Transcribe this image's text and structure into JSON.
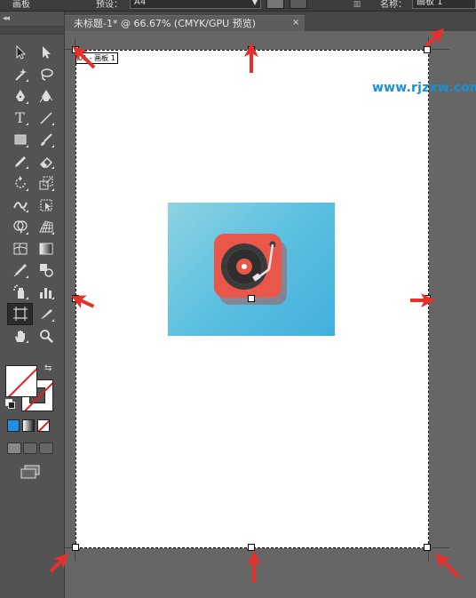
{
  "control_bar": {
    "tool_name": "画板",
    "preset_label": "预设：",
    "preset_value": "A4",
    "name_label": "名称：",
    "name_value": "画板 1"
  },
  "document": {
    "tab_title": "未标题-1* @ 66.67% (CMYK/GPU 预览)",
    "tab_close": "×"
  },
  "artboard": {
    "label": "01 - 画板 1"
  },
  "watermark": "www.rjzxw.com",
  "colors": {
    "fill": "#ffffff",
    "stroke": "none",
    "annotation_arrow": "#e8302a",
    "watermark": "#1a8fd6",
    "icon_background": "#5cc0e0",
    "icon_tile": "#e8574a"
  },
  "tools": [
    "selection-tool",
    "direct-selection-tool",
    "magic-wand-tool",
    "lasso-tool",
    "pen-tool",
    "curvature-tool",
    "type-tool",
    "line-segment-tool",
    "rectangle-tool",
    "paintbrush-tool",
    "pencil-tool",
    "eraser-tool",
    "rotate-tool",
    "scale-tool",
    "width-tool",
    "free-transform-tool",
    "shape-builder-tool",
    "perspective-grid-tool",
    "mesh-tool",
    "gradient-tool",
    "eyedropper-tool",
    "blend-tool",
    "symbol-sprayer-tool",
    "column-graph-tool",
    "artboard-tool",
    "slice-tool",
    "hand-tool",
    "zoom-tool"
  ],
  "tool_letters": {
    "type": "T"
  },
  "control_bar_glyphs": {
    "more": "▥"
  },
  "panel_glyphs": {
    "collapse": "◂◂",
    "swap": "⇆"
  }
}
